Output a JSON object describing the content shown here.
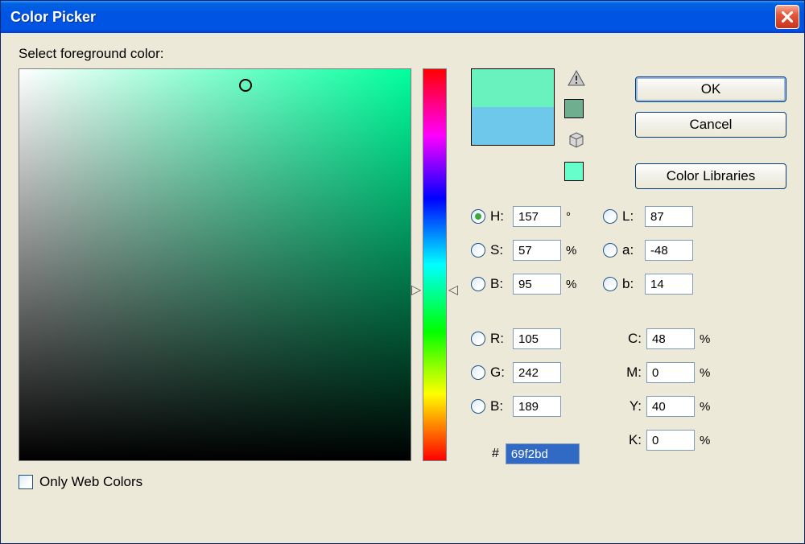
{
  "window": {
    "title": "Color Picker"
  },
  "prompt": "Select foreground color:",
  "swatch": {
    "new_color": "#69f2bd",
    "old_color": "#6ec8ec",
    "gamut_swatch": "#6fae8e",
    "websafe_swatch": "#66ffcc"
  },
  "fields": {
    "H": {
      "label": "H:",
      "value": "157",
      "unit": "°"
    },
    "S": {
      "label": "S:",
      "value": "57",
      "unit": "%"
    },
    "Bv": {
      "label": "B:",
      "value": "95",
      "unit": "%"
    },
    "R": {
      "label": "R:",
      "value": "105"
    },
    "G": {
      "label": "G:",
      "value": "242"
    },
    "Bb": {
      "label": "B:",
      "value": "189"
    },
    "L": {
      "label": "L:",
      "value": "87"
    },
    "a": {
      "label": "a:",
      "value": "-48"
    },
    "b": {
      "label": "b:",
      "value": "14"
    },
    "C": {
      "label": "C:",
      "value": "48",
      "unit": "%"
    },
    "M": {
      "label": "M:",
      "value": "0",
      "unit": "%"
    },
    "Y": {
      "label": "Y:",
      "value": "40",
      "unit": "%"
    },
    "K": {
      "label": "K:",
      "value": "0",
      "unit": "%"
    }
  },
  "hex": {
    "label": "#",
    "value": "69f2bd"
  },
  "buttons": {
    "ok": "OK",
    "cancel": "Cancel",
    "libraries": "Color Libraries"
  },
  "web_colors_label": "Only Web Colors",
  "selected_model": "H",
  "hue_position_pct": 56.5
}
